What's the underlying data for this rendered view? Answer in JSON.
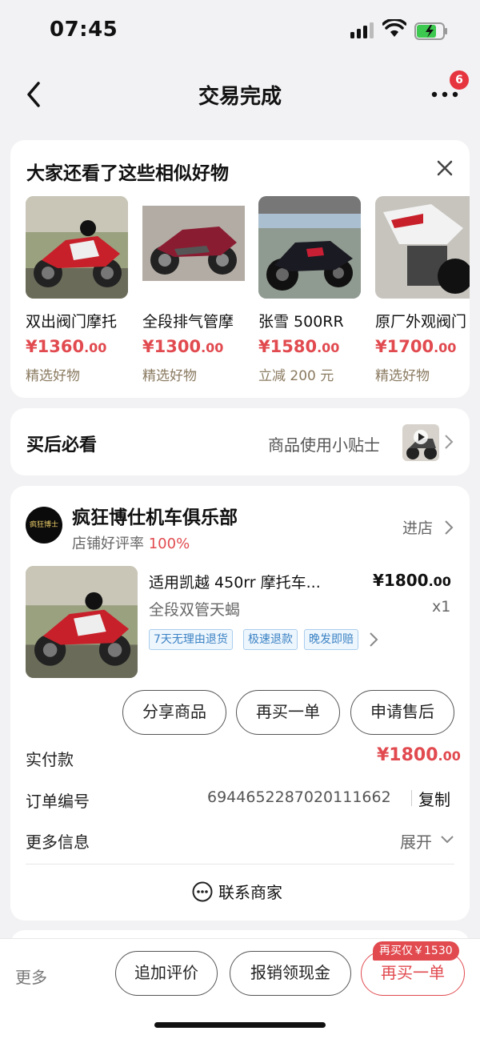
{
  "status_bar": {
    "time": "07:45"
  },
  "header": {
    "title": "交易完成",
    "badge_count": "6"
  },
  "similar": {
    "title": "大家还看了这些相似好物",
    "items": [
      {
        "name": "双出阀门摩托",
        "price_main": "¥1360",
        "price_dec": ".00",
        "sub": "精选好物"
      },
      {
        "name": "全段排气管摩",
        "price_main": "¥1300",
        "price_dec": ".00",
        "sub": "精选好物"
      },
      {
        "name": "张雪 500RR",
        "price_main": "¥1580",
        "price_dec": ".00",
        "sub": "立减 200 元"
      },
      {
        "name": "原厂外观阀门",
        "price_main": "¥1700",
        "price_dec": ".00",
        "sub": "精选好物"
      }
    ]
  },
  "after": {
    "title": "买后必看",
    "tip": "商品使用小贴士"
  },
  "shop": {
    "name": "疯狂博仕机车俱乐部",
    "rating_label": "店铺好评率",
    "rating_value": "100%",
    "enter": "进店",
    "logo_text": "疯狂博士"
  },
  "order_item": {
    "title": "适用凯越 450rr 摩托车...",
    "spec": "全段双管天蝎",
    "price_main": "¥1800",
    "price_dec": ".00",
    "qty": "x1",
    "tags": [
      "7天无理由退货",
      "极速退款",
      "晚发即赔"
    ]
  },
  "actions": {
    "share": "分享商品",
    "rebuy": "再买一单",
    "after_sale": "申请售后"
  },
  "paid": {
    "label": "实付款",
    "price_main": "¥1800",
    "price_dec": ".00"
  },
  "order_no": {
    "label": "订单编号",
    "value": "6944652287020111662",
    "copy": "复制"
  },
  "more_info": {
    "label": "更多信息",
    "expand": "展开"
  },
  "contact": {
    "label": "联系商家"
  },
  "bottom_bar": {
    "more": "更多",
    "review": "追加评价",
    "cashback": "报销领现金",
    "rebuy": "再买一单",
    "rebuy_badge": "再买仅￥1530"
  },
  "colors": {
    "accent": "#e14a4f",
    "tag_blue": "#3b82c4"
  }
}
